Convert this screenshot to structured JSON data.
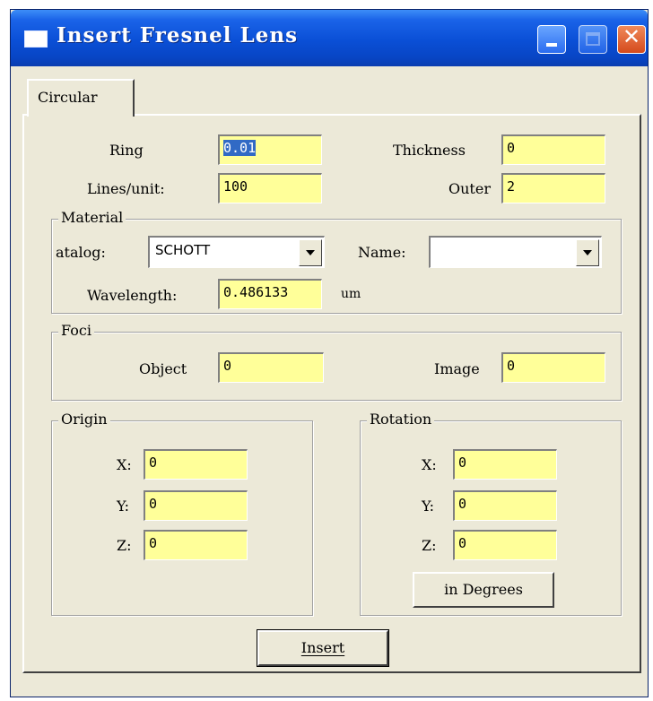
{
  "window": {
    "title": "Insert Fresnel Lens",
    "accent_color": "#0a4fd6",
    "close_color": "#d44a1c"
  },
  "tabs": [
    {
      "label": "Circular",
      "active": true
    }
  ],
  "lens": {
    "ring_label": "Ring",
    "ring_value": "0.01",
    "thickness_label": "Thickness",
    "thickness_value": "0",
    "lines_label": "Lines/unit:",
    "lines_value": "100",
    "outer_label": "Outer",
    "outer_value": "2"
  },
  "material": {
    "group_title": "Material",
    "catalog_label": "atalog:",
    "catalog_value": "SCHOTT",
    "name_label": "Name:",
    "name_value": "",
    "wavelength_label": "Wavelength:",
    "wavelength_value": "0.486133",
    "wavelength_unit": "um"
  },
  "foci": {
    "group_title": "Foci",
    "object_label": "Object",
    "object_value": "0",
    "image_label": "Image",
    "image_value": "0"
  },
  "origin": {
    "group_title": "Origin",
    "x_label": "X:",
    "x_value": "0",
    "y_label": "Y:",
    "y_value": "0",
    "z_label": "Z:",
    "z_value": "0"
  },
  "rotation": {
    "group_title": "Rotation",
    "x_label": "X:",
    "x_value": "0",
    "y_label": "Y:",
    "y_value": "0",
    "z_label": "Z:",
    "z_value": "0",
    "units_button": "in Degrees"
  },
  "actions": {
    "insert_label": "Insert"
  },
  "field_color": "#ffff99"
}
